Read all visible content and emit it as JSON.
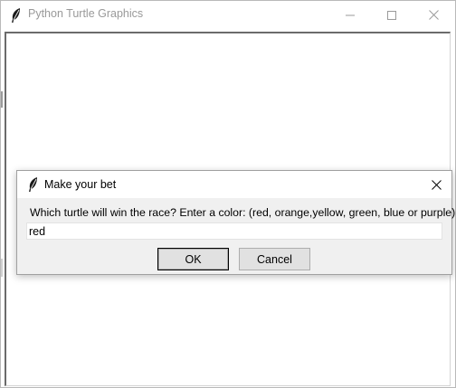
{
  "main_window": {
    "title": "Python Turtle Graphics",
    "controls": [
      "minimize",
      "maximize",
      "close"
    ]
  },
  "dialog": {
    "title": "Make your bet",
    "prompt": "Which turtle will win the race? Enter a color: (red, orange,yellow, green, blue or purple)",
    "input_value": "red",
    "ok_label": "OK",
    "cancel_label": "Cancel"
  },
  "icons": {
    "app": "feather-icon",
    "minimize": "minimize-icon",
    "maximize": "maximize-icon",
    "close": "close-icon"
  },
  "colors": {
    "title_inactive": "#999999",
    "dialog_bg": "#f0f0f0",
    "button_bg": "#e1e1e1"
  }
}
